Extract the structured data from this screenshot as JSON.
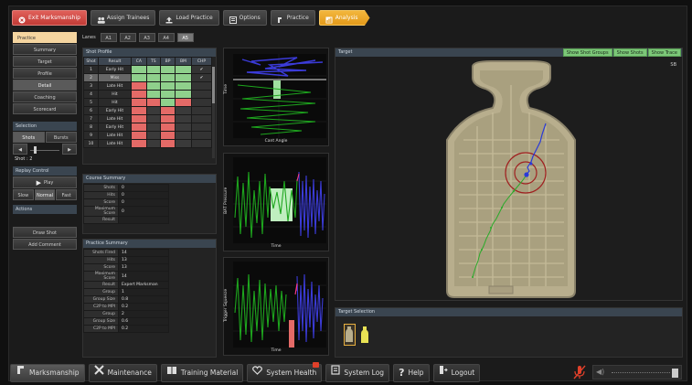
{
  "toolbar": {
    "exit": "Exit Marksmanship",
    "assign": "Assign Trainees",
    "load": "Load Practice",
    "options": "Options",
    "practice": "Practice",
    "analysis": "Analysis"
  },
  "sidebar": {
    "practice": "Practice",
    "items": [
      "Summary",
      "Target",
      "Profile",
      "Detail",
      "Coaching",
      "Scorecard"
    ],
    "selection": "Selection",
    "shots": "Shots",
    "bursts": "Bursts",
    "shot_label": "Shot : 2",
    "replay_control": "Replay Control",
    "play": "Play",
    "slow": "Slow",
    "normal": "Normal",
    "fast": "Fast",
    "actions": "Actions",
    "draw_shot": "Draw Shot",
    "add_comment": "Add Comment"
  },
  "lanes": {
    "label": "Lanes",
    "items": [
      "A1",
      "A2",
      "A3",
      "A4",
      "A5"
    ]
  },
  "shot_profile": {
    "title": "Shot Profile",
    "headers": [
      "Shot",
      "Result",
      "CA",
      "TS",
      "BP",
      "BM",
      "CHP"
    ],
    "rows": [
      {
        "shot": "1",
        "result": "Early Hit",
        "c": [
          "g",
          "g",
          "g",
          "g"
        ],
        "chk": "✔"
      },
      {
        "shot": "2",
        "result": "Miss",
        "c": [
          "g",
          "g",
          "g",
          "g"
        ],
        "chk": "✔"
      },
      {
        "shot": "3",
        "result": "Late Hit",
        "c": [
          "r",
          "g",
          "g",
          "g"
        ],
        "chk": ""
      },
      {
        "shot": "4",
        "result": "Hit",
        "c": [
          "r",
          "g",
          "g",
          "g"
        ],
        "chk": ""
      },
      {
        "shot": "5",
        "result": "Hit",
        "c": [
          "r",
          "r",
          "g",
          "r"
        ],
        "chk": ""
      },
      {
        "shot": "6",
        "result": "Early Hit",
        "c": [
          "r",
          "n",
          "r",
          "n"
        ],
        "chk": ""
      },
      {
        "shot": "7",
        "result": "Late Hit",
        "c": [
          "r",
          "n",
          "r",
          "n"
        ],
        "chk": ""
      },
      {
        "shot": "8",
        "result": "Early Hit",
        "c": [
          "r",
          "n",
          "r",
          "n"
        ],
        "chk": ""
      },
      {
        "shot": "9",
        "result": "Late Hit",
        "c": [
          "r",
          "n",
          "r",
          "n"
        ],
        "chk": ""
      },
      {
        "shot": "10",
        "result": "Late Hit",
        "c": [
          "r",
          "n",
          "r",
          "n"
        ],
        "chk": ""
      }
    ]
  },
  "course_summary": {
    "title": "Course Summary",
    "rows": [
      {
        "k": "Shots",
        "v": "0"
      },
      {
        "k": "Hits",
        "v": "0"
      },
      {
        "k": "Score",
        "v": "0"
      },
      {
        "k": "Maximum Score",
        "v": "0"
      },
      {
        "k": "Result",
        "v": ""
      }
    ]
  },
  "practice_summary": {
    "title": "Practice Summary",
    "rows": [
      {
        "k": "Shots Fired",
        "v": "14"
      },
      {
        "k": "Hits",
        "v": "13"
      },
      {
        "k": "Score",
        "v": "13"
      },
      {
        "k": "Maximum Score",
        "v": "14"
      },
      {
        "k": "Result",
        "v": "Expert Marksman"
      },
      {
        "k": "Group",
        "v": "1"
      },
      {
        "k": "Group Size",
        "v": "0.8"
      },
      {
        "k": "C2P to MPI",
        "v": "0.2"
      },
      {
        "k": "Group",
        "v": "2"
      },
      {
        "k": "Group Size",
        "v": "0.6"
      },
      {
        "k": "C2P to MPI",
        "v": "0.2"
      }
    ]
  },
  "graphs": {
    "g1_ylabel": "Time",
    "g1_xlabel": "Cant Angle",
    "g2_ylabel": "BAT Pressure",
    "g2_xlabel": "Time",
    "g3_ylabel": "Trigger Squeeze",
    "g3_xlabel": "Time"
  },
  "target": {
    "title": "Target",
    "btn_groups": "Show Shot Groups",
    "btn_shots": "Show Shots",
    "btn_trace": "Show Trace",
    "corner": "SB",
    "selection_title": "Target Selection"
  },
  "bottom": {
    "marksmanship": "Marksmanship",
    "maintenance": "Maintenance",
    "training": "Training Material",
    "health": "System Health",
    "log": "System Log",
    "help": "Help",
    "logout": "Logout"
  },
  "colors": {
    "accent_red": "#d24b45",
    "accent_orange": "#eaa42a",
    "green": "#8fd08c",
    "red": "#e46a67"
  }
}
